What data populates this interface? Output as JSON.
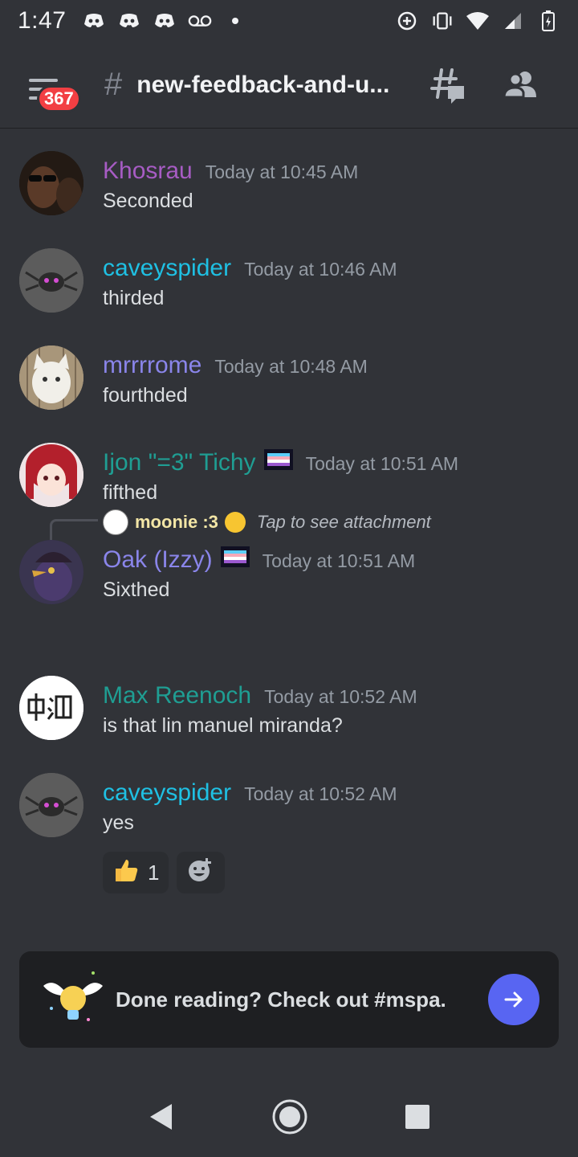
{
  "status_bar": {
    "time": "1:47"
  },
  "header": {
    "badge_count": "367",
    "channel_name": "new-feedback-and-u..."
  },
  "messages": [
    {
      "author": "Khosrau",
      "author_color": "#a75cc4",
      "timestamp": "Today at 10:45 AM",
      "text": "Seconded"
    },
    {
      "author": "caveyspider",
      "author_color": "#1fc0e3",
      "timestamp": "Today at 10:46 AM",
      "text": "thirded"
    },
    {
      "author": "mrrrrome",
      "author_color": "#8a85ea",
      "timestamp": "Today at 10:48 AM",
      "text": "fourthded"
    },
    {
      "author": "Ijon \"=3\" Tichy",
      "author_color": "#1f9e93",
      "timestamp": "Today at 10:51 AM",
      "text": "fifthed"
    },
    {
      "author": "Oak (Izzy)",
      "author_color": "#8a85ea",
      "timestamp": "Today at 10:51 AM",
      "text": "Sixthed"
    },
    {
      "author": "Max Reenoch",
      "author_color": "#1f9e93",
      "timestamp": "Today at 10:52 AM",
      "text": "is that lin manuel miranda?"
    },
    {
      "author": "caveyspider",
      "author_color": "#1fc0e3",
      "timestamp": "Today at 10:52 AM",
      "text": "yes"
    }
  ],
  "reply": {
    "author": "moonie :3",
    "text": "Tap to see attachment"
  },
  "reactions": {
    "thumbs_up_count": "1"
  },
  "done_card": {
    "text": "Done reading? Check out #mspa."
  },
  "colors": {
    "background": "#313338",
    "accent": "#5865f2",
    "badge": "#f23f43"
  }
}
